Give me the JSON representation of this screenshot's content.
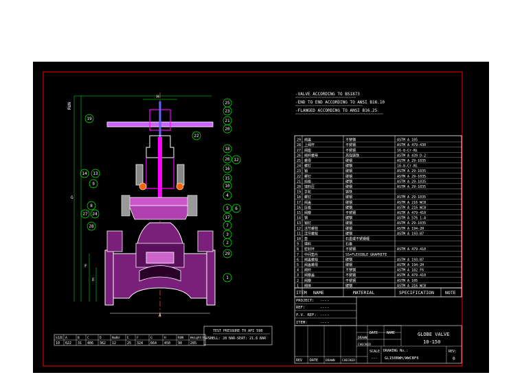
{
  "notes": [
    "-VALVE ACCORDING TO BS1873",
    "-END TO END ACCORDING TO ANSI B16.10",
    "-FLANGED ACCORDING TO ANSI B16.25"
  ],
  "parts_list": [
    {
      "item": "29",
      "name": "阀盖",
      "material": "不锈钢",
      "spec": "ASTM A 105"
    },
    {
      "item": "28",
      "name": "上阀杆",
      "material": "不锈钢",
      "spec": "ASTM A 479-430"
    },
    {
      "item": "27",
      "name": "阀座",
      "material": "不锈钢",
      "spec": "16-8-Cr-Ni"
    },
    {
      "item": "26",
      "name": "阀杆螺母",
      "material": "高强铸铁",
      "spec": "ASTM A 439 D-2"
    },
    {
      "item": "25",
      "name": "螺母",
      "material": "碳钢",
      "spec": "ASTM A 29-1035"
    },
    {
      "item": "24",
      "name": "螺钉",
      "material": "碳钢",
      "spec": "16-8-Cr-Ni"
    },
    {
      "item": "23",
      "name": "销",
      "material": "碳钢",
      "spec": "ASTM A 29-1035"
    },
    {
      "item": "22",
      "name": "螺钉",
      "material": "碳钢",
      "spec": "ASTM A 29-1035"
    },
    {
      "item": "21",
      "name": "挡板",
      "material": "碳钢",
      "spec": "ASTM A 29-1035"
    },
    {
      "item": "20",
      "name": "填料压",
      "material": "碳钢",
      "spec": "ASTM A 29-1035"
    },
    {
      "item": "19",
      "name": "手轮",
      "material": "铸铁",
      "spec": ""
    },
    {
      "item": "18",
      "name": "螺钉",
      "material": "碳钢",
      "spec": "ASTM A 29-1035"
    },
    {
      "item": "17",
      "name": "阀盖",
      "material": "碳钢",
      "spec": "ASTM A 216 WCB"
    },
    {
      "item": "16",
      "name": "压板",
      "material": "碳钢",
      "spec": "ASTM A 216 WCB"
    },
    {
      "item": "15",
      "name": "阀瓣",
      "material": "不锈钢",
      "spec": "ASTM A 479-410"
    },
    {
      "item": "14",
      "name": "销",
      "material": "碳钢",
      "spec": "ASTM A 576 1-A"
    },
    {
      "item": "13",
      "name": "销钉",
      "material": "碳钢",
      "spec": "ASTM A 29-1035"
    },
    {
      "item": "12",
      "name": "活节螺栓",
      "material": "碳钢",
      "spec": "ASTM A 194-2H"
    },
    {
      "item": "11",
      "name": "活节螺栓",
      "material": "碳钢",
      "spec": "ASTM A 193-B7"
    },
    {
      "item": "10",
      "name": "垫",
      "material": "石墨或不锈钢缠",
      "spec": ""
    },
    {
      "item": "9",
      "name": "填料",
      "material": "石墨",
      "spec": ""
    },
    {
      "item": "8",
      "name": "密封环",
      "material": "不锈钢",
      "spec": "ASTM A 479-410"
    },
    {
      "item": "7",
      "name": "中间垫片",
      "material": "SS+FLEXIBLE GRAPHITE",
      "spec": ""
    },
    {
      "item": "6",
      "name": "阀盖螺栓",
      "material": "碳钢",
      "spec": "ASTM A 193-B7"
    },
    {
      "item": "5",
      "name": "阀盖螺母",
      "material": "碳钢",
      "spec": "ASTM A 194-2H"
    },
    {
      "item": "4",
      "name": "阀杆",
      "material": "不锈钢",
      "spec": "ASTM A 182 F6"
    },
    {
      "item": "3",
      "name": "阀瓣盖",
      "material": "不锈钢",
      "spec": "ASTM A 479-410"
    },
    {
      "item": "2",
      "name": "阀瓣",
      "material": "不锈钢",
      "spec": "ASTM A 105"
    },
    {
      "item": "1",
      "name": "阀体",
      "material": "碳钢",
      "spec": "ASTM A 216 WCB"
    }
  ],
  "parts_header": {
    "item": "ITEM",
    "name": "NAME",
    "material": "MATERIAL",
    "spec": "SPECIFICATION",
    "note": "NOTE"
  },
  "project_block": {
    "project": "PROJECT:",
    "ref": "REF:",
    "pv_ref": "P.V. REF:",
    "item": "ITEM:",
    "dashes": "----"
  },
  "test_box": {
    "title": "TEST PRESSURE TO API 598",
    "shell": "-SHELL: 28 BAR",
    "seat": "-SEAT: 21.6 BAR"
  },
  "dim_table": {
    "headers": [
      "SIZE",
      "A",
      "B",
      "C",
      "D",
      "NxØd",
      "E",
      "F",
      "G",
      "H",
      "RUN",
      "Weight(Kg)"
    ],
    "row": [
      "10",
      "622",
      "31",
      "406",
      "362",
      "12",
      "25",
      "324",
      "664",
      "450",
      "90",
      "285"
    ]
  },
  "title_block": {
    "date": "DATE",
    "name": "NAME",
    "drawn": "DRAWN",
    "checked": "CHECKED",
    "title_line1": "GLOBE VALVE",
    "title_line2": "10-150",
    "scale": "SCALE",
    "scale_val": "---",
    "drawing_no_label": "DRAWING No.:",
    "drawing_no": "GL150BWH/WWCBF6",
    "rev": "REV:",
    "rev_val": "0",
    "rev_row": [
      "REV",
      "DATE",
      "DRAWN",
      "CHECKED"
    ]
  },
  "balloons": [
    "25",
    "23",
    "21",
    "20",
    "22",
    "19",
    "18",
    "26",
    "12",
    "16",
    "14",
    "13",
    "15",
    "10",
    "4",
    "9",
    "8",
    "27",
    "24",
    "5",
    "6",
    "17",
    "7",
    "3",
    "2",
    "28",
    "29",
    "1"
  ],
  "dim_labels": {
    "h": "H",
    "a": "A",
    "b": "B",
    "c": "C",
    "d": "D",
    "e": "E",
    "f": "F",
    "g": "G",
    "run": "RUN"
  }
}
